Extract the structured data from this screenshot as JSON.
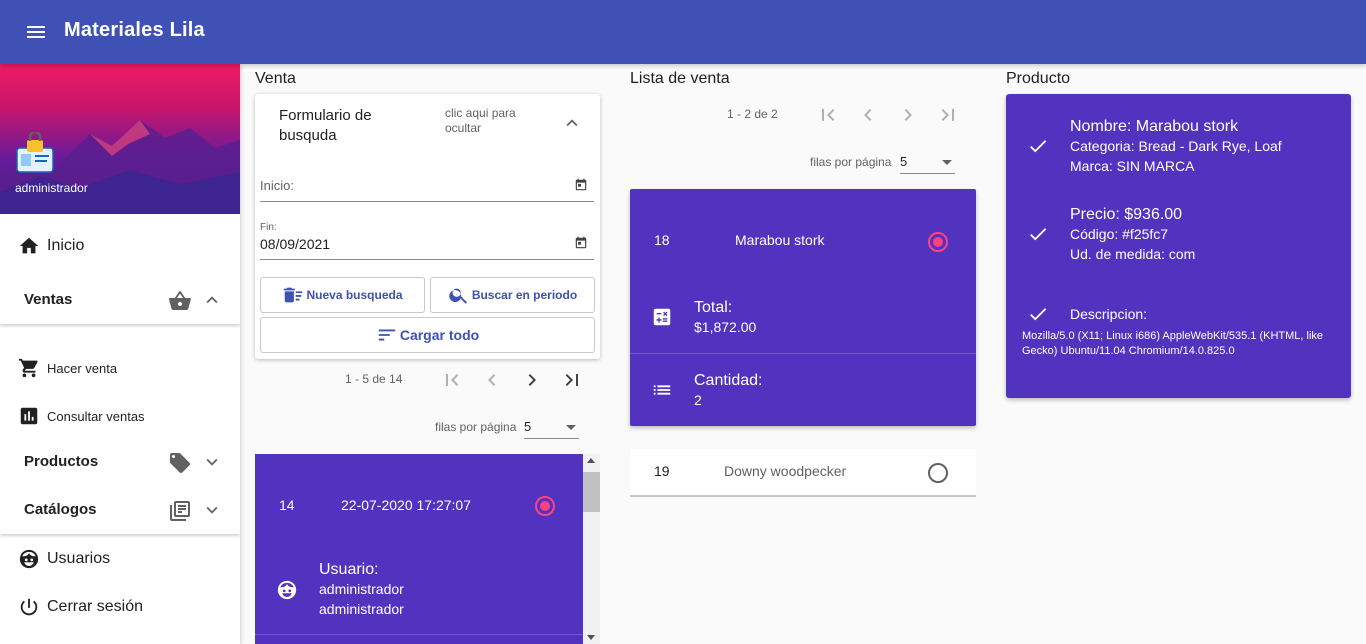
{
  "app": {
    "title": "Materiales Lila"
  },
  "sidebar": {
    "user_name": "administrador",
    "inicio": "Inicio",
    "ventas": "Ventas",
    "hacer_venta": "Hacer venta",
    "consultar_ventas": "Consultar ventas",
    "productos": "Productos",
    "catalogos": "Catálogos",
    "usuarios": "Usuarios",
    "cerrar_sesion": "Cerrar sesión"
  },
  "venta": {
    "section_title": "Venta",
    "form": {
      "title": "Formulario de busquda",
      "hint": "clic aqui para ocultar",
      "inicio_label": "Inicio:",
      "inicio_value": "",
      "fin_label": "Fin:",
      "fin_value": "08/09/2021",
      "nueva_busqueda": "Nueva busqueda",
      "buscar_periodo": "Buscar en periodo",
      "cargar_todo": "Cargar todo"
    },
    "paginator": {
      "range": "1 - 5 de 14",
      "rows_label": "filas por página",
      "rows_value": "5"
    },
    "sale": {
      "id": "14",
      "date": "22-07-2020 17:27:07",
      "user_label": "Usuario:",
      "user_line1": "administrador",
      "user_line2": "administrador"
    }
  },
  "lista": {
    "section_title": "Lista de venta",
    "paginator": {
      "range": "1 - 2 de 2",
      "rows_label": "filas por página",
      "rows_value": "5"
    },
    "item1": {
      "id": "18",
      "name": "Marabou stork",
      "total_label": "Total:",
      "total_value": "$1,872.00",
      "qty_label": "Cantidad:",
      "qty_value": "2"
    },
    "item2": {
      "id": "19",
      "name": "Downy woodpecker"
    }
  },
  "producto": {
    "section_title": "Producto",
    "nombre": "Nombre: Marabou stork",
    "categoria": "Categoria: Bread - Dark Rye, Loaf",
    "marca": "Marca: SIN MARCA",
    "precio": "Precio: $936.00",
    "codigo": "Código: #f25fc7",
    "unidad": "Ud. de medida: com",
    "descripcion_label": "Descripcion:",
    "descripcion": "Mozilla/5.0 (X11; Linux i686) AppleWebKit/535.1 (KHTML, like Gecko) Ubuntu/11.04 Chromium/14.0.825.0"
  },
  "colors": {
    "primary": "#3f51b5",
    "card": "#5133bf",
    "accent": "#ff4081"
  },
  "icons": [
    "menu-icon",
    "home-icon",
    "basket-icon",
    "cart-icon",
    "chart-icon",
    "tag-icon",
    "library-icon",
    "face-icon",
    "power-icon",
    "calendar-icon",
    "delete-sweep-icon",
    "search-icon",
    "sort-icon",
    "first-page-icon",
    "chevron-left-icon",
    "chevron-right-icon",
    "last-page-icon",
    "calculator-icon",
    "list-icon",
    "check-icon"
  ]
}
